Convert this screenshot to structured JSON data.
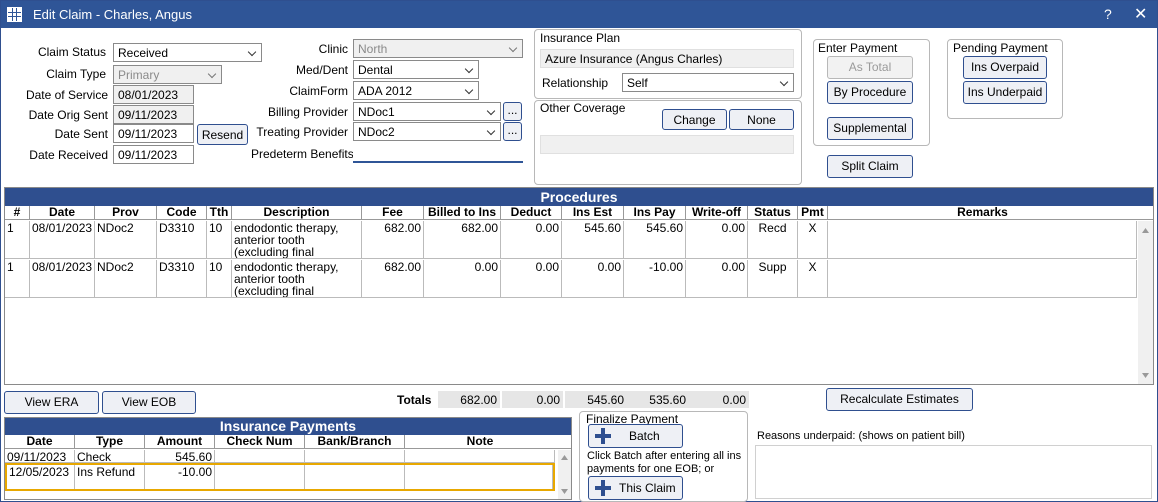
{
  "window": {
    "title": "Edit Claim - Charles, Angus",
    "help": "?",
    "close": "✕"
  },
  "claim": {
    "status_label": "Claim Status",
    "status": "Received",
    "type_label": "Claim Type",
    "type": "Primary",
    "dos_label": "Date of Service",
    "dos": "08/01/2023",
    "orig_sent_label": "Date Orig Sent",
    "orig_sent": "09/11/2023",
    "sent_label": "Date Sent",
    "sent": "09/11/2023",
    "resend": "Resend",
    "received_label": "Date Received",
    "received": "09/11/2023"
  },
  "clinic": {
    "clinic_label": "Clinic",
    "clinic": "North",
    "meddent_label": "Med/Dent",
    "meddent": "Dental",
    "claimform_label": "ClaimForm",
    "claimform": "ADA 2012",
    "billing_label": "Billing Provider",
    "billing": "NDoc1",
    "treating_label": "Treating Provider",
    "treating": "NDoc2",
    "ellipsis": "...",
    "predeterm_label": "Predeterm Benefits",
    "predeterm": ""
  },
  "insurance_plan": {
    "title": "Insurance Plan",
    "plan": "Azure Insurance (Angus Charles)",
    "relationship_label": "Relationship",
    "relationship": "Self",
    "other_title": "Other Coverage",
    "change": "Change",
    "none": "None",
    "other_value": ""
  },
  "enter_payment": {
    "title": "Enter Payment",
    "as_total": "As Total",
    "by_procedure": "By Procedure",
    "supplemental": "Supplemental"
  },
  "pending_payment": {
    "title": "Pending Payment",
    "overpaid": "Ins Overpaid",
    "underpaid": "Ins Underpaid"
  },
  "split_claim": "Split Claim",
  "procedures": {
    "title": "Procedures",
    "columns": [
      "#",
      "Date",
      "Prov",
      "Code",
      "Tth",
      "Description",
      "Fee",
      "Billed to Ins",
      "Deduct",
      "Ins Est",
      "Ins Pay",
      "Write-off",
      "Status",
      "Pmt",
      "Remarks"
    ],
    "rows": [
      [
        "1",
        "08/01/2023",
        "NDoc2",
        "D3310",
        "10",
        "endodontic therapy, anterior tooth (excluding final restoration)",
        "682.00",
        "682.00",
        "0.00",
        "545.60",
        "545.60",
        "0.00",
        "Recd",
        "X",
        ""
      ],
      [
        "1",
        "08/01/2023",
        "NDoc2",
        "D3310",
        "10",
        "endodontic therapy, anterior tooth (excluding final restoration)",
        "682.00",
        "0.00",
        "0.00",
        "0.00",
        "-10.00",
        "0.00",
        "Supp",
        "X",
        ""
      ]
    ]
  },
  "view_era": "View ERA",
  "view_eob": "View EOB",
  "totals": {
    "label": "Totals",
    "fee": "682.00",
    "billed": "",
    "deduct": "0.00",
    "ins_est": "545.60",
    "ins_pay": "535.60",
    "writeoff": "0.00"
  },
  "recalculate": "Recalculate Estimates",
  "ins_payments": {
    "title": "Insurance Payments",
    "columns": [
      "Date",
      "Type",
      "Amount",
      "Check Num",
      "Bank/Branch",
      "Note"
    ],
    "rows": [
      [
        "09/11/2023",
        "Check",
        "545.60",
        "",
        "",
        ""
      ],
      [
        "12/05/2023",
        "Ins Refund",
        "-10.00",
        "",
        "",
        ""
      ]
    ]
  },
  "finalize": {
    "title": "Finalize Payment",
    "batch": "Batch",
    "instructions": "Click Batch after entering all ins payments for one EOB; or",
    "this_claim": "This Claim"
  },
  "reasons_label": "Reasons underpaid:  (shows on patient bill)",
  "reasons_value": "",
  "colors": {
    "title_bar": "#2f5597",
    "grid_header": "#2f4f8f",
    "selected_row_border": "#e8a800"
  }
}
